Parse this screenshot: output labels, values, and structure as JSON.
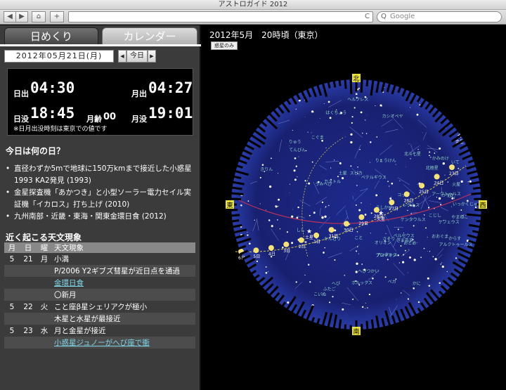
{
  "window": {
    "title": "アストロガイド 2012"
  },
  "toolbar": {
    "search_placeholder": "Google",
    "back": "◀",
    "forward": "▶",
    "home": "⌂",
    "add": "+",
    "reload": "C",
    "search_icon": "Q"
  },
  "tabs": {
    "day": "日めくり",
    "calendar": "カレンダー"
  },
  "date": {
    "value": "2012年05月21日(月)",
    "prev": "◀",
    "today": "今日",
    "next": "▶"
  },
  "rise": {
    "sunrise_label": "日出",
    "sunrise": "04:30",
    "moonrise_label": "月出",
    "moonrise": "04:27",
    "sunset_label": "日没",
    "sunset": "18:45",
    "moonage_label": "月齢",
    "moonage": "00",
    "moonset_label": "月没",
    "moonset": "19:01",
    "note": "※日月出没時刻は東京での値です"
  },
  "today": {
    "title": "今日は何の日？",
    "items": [
      "直径わずか5mで地球に150万kmまで接近した小惑星1993 KA2発見 (1993)",
      "金星探査機「あかつき」と小型ソーラー電力セイル実証機「イカロス」打ち上げ (2010)",
      "九州南部・近畿・東海・関東金環日食 (2012)"
    ]
  },
  "events": {
    "title": "近く起こる天文現象",
    "headers": [
      "月",
      "日",
      "曜",
      "天文現象"
    ],
    "rows": [
      {
        "m": "5",
        "d": "21",
        "w": "月",
        "e": "小満",
        "link": false
      },
      {
        "m": "",
        "d": "",
        "w": "",
        "e": "P/2006 Y2ギブズ彗星が近日点を通過",
        "link": false
      },
      {
        "m": "",
        "d": "",
        "w": "",
        "e": "金環日食",
        "link": true
      },
      {
        "m": "",
        "d": "",
        "w": "",
        "e": "〇新月",
        "link": false
      },
      {
        "m": "5",
        "d": "22",
        "w": "火",
        "e": "こと座β星シェリアクが極小",
        "link": false
      },
      {
        "m": "",
        "d": "",
        "w": "",
        "e": "木星と水星が最接近",
        "link": false
      },
      {
        "m": "5",
        "d": "23",
        "w": "水",
        "e": "月と金星が接近",
        "link": false
      },
      {
        "m": "",
        "d": "",
        "w": "",
        "e": "小惑星ジュノーがへび座で衝",
        "link": true
      }
    ]
  },
  "sky": {
    "title": "2012年5月　20時頃（東京）",
    "planet_button": "惑星のみ",
    "directions": {
      "north": "北",
      "south": "南",
      "east": "東",
      "west": "西"
    },
    "constellations": [
      "カシオペヤ",
      "ケフェウス",
      "ペルセウス",
      "ぎょしゃ",
      "カペラ",
      "りゅう",
      "こぐま",
      "北極星",
      "きりん",
      "ヘルクレス",
      "ベガ",
      "こと",
      "はくちょう",
      "デネブ",
      "おおぐま",
      "北斗七星",
      "やまねこ",
      "ふたご",
      "カストル",
      "ポルックス",
      "こいぬ",
      "プロキオン",
      "かに",
      "しし",
      "レグルス",
      "うしかい",
      "アークトゥルス",
      "かんむり",
      "へびつかい",
      "へび",
      "てんびん",
      "おとめ",
      "スピカ",
      "からす",
      "コップ",
      "うみへび",
      "ケンタウルス",
      "さそり",
      "アンタレス",
      "いて",
      "わし",
      "かみのけ",
      "こじし",
      "りょうけん",
      "アルクトゥールス",
      "土星",
      "火星",
      "いっかくじゅう",
      "オリオン",
      "ベテルギウス"
    ],
    "moon_days": [
      "6日",
      "5日",
      "4日",
      "3日",
      "2日",
      "1日",
      "31日",
      "30日",
      "29日",
      "28日",
      "27日",
      "26日",
      "25日",
      "24日",
      "23日"
    ],
    "star_labels": [
      "土星",
      "火星",
      "金星"
    ]
  }
}
